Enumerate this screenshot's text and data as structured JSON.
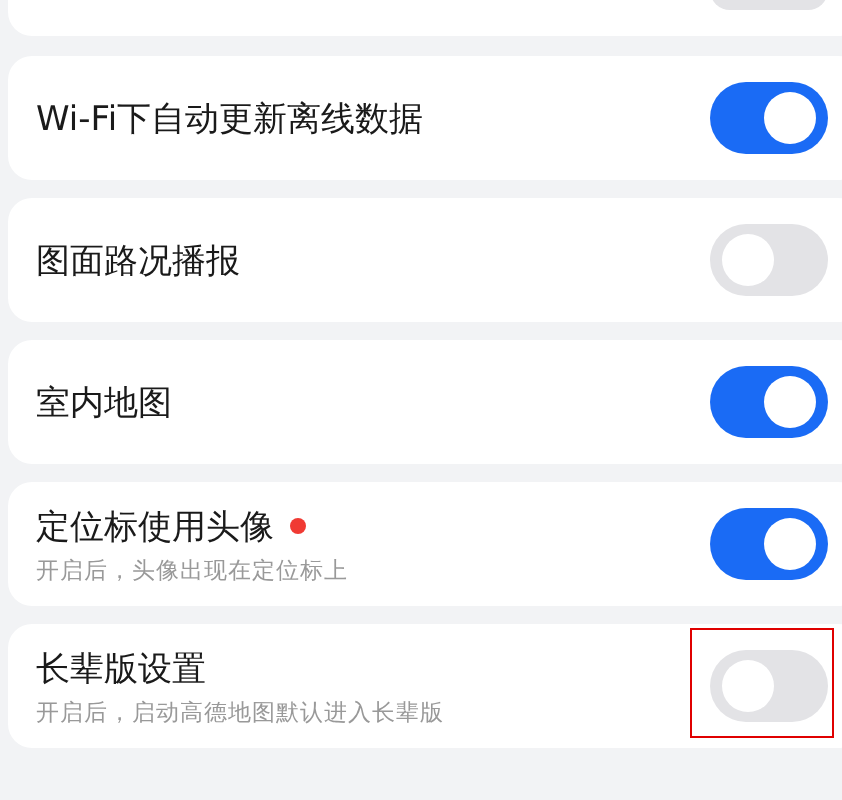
{
  "settings": [
    {
      "on": false,
      "cut": true
    },
    {
      "label": "Wi-Fi下自动更新离线数据",
      "on": true
    },
    {
      "label": "图面路况播报",
      "on": false
    },
    {
      "label": "室内地图",
      "on": true
    },
    {
      "label": "定位标使用头像",
      "subtitle": "开启后，头像出现在定位标上",
      "on": true,
      "badge": true
    },
    {
      "label": "长辈版设置",
      "subtitle": "开启后，启动高德地图默认进入长辈版",
      "on": false,
      "highlighted": true
    }
  ]
}
